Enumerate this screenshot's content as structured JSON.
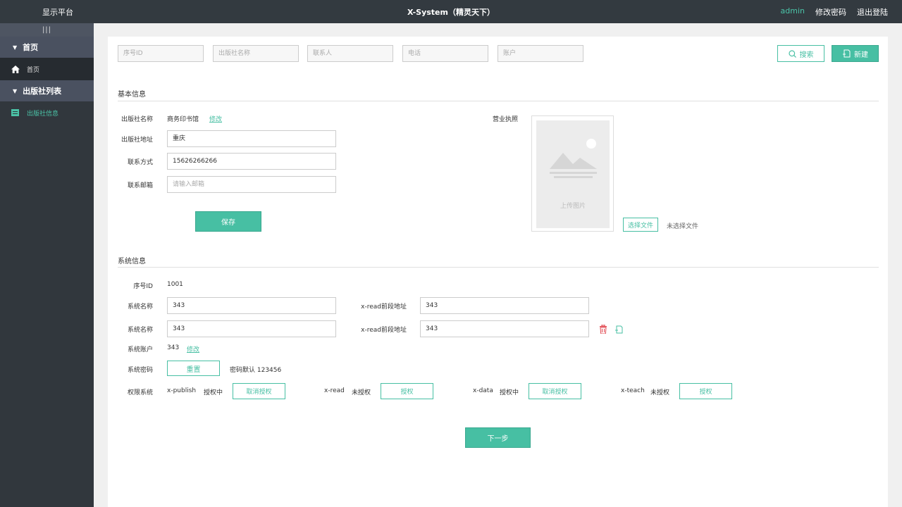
{
  "topbar": {
    "brand": "显示平台",
    "title": "X-System（精灵天下）",
    "user": "admin",
    "change_password": "修改密码",
    "logout": "退出登陆"
  },
  "sidebar": {
    "collapse": "|||",
    "groups": [
      {
        "label": "首页",
        "items": [
          {
            "label": "首页",
            "icon": "home-icon"
          }
        ]
      },
      {
        "label": "出版社列表",
        "items": [
          {
            "label": "出版社信息",
            "icon": "list-icon"
          }
        ]
      }
    ]
  },
  "search": {
    "placeholders": [
      "序号ID",
      "出版社名称",
      "联系人",
      "电话",
      "账户"
    ],
    "search_label": "搜索",
    "new_label": "新建"
  },
  "basic": {
    "section_title": "基本信息",
    "name_label": "出版社名称",
    "name_value": "商务印书馆",
    "edit_link": "修改",
    "address_label": "出版社地址",
    "address_value": "重庆",
    "phone_label": "联系方式",
    "phone_value": "15626266266",
    "email_label": "联系邮箱",
    "email_placeholder": "请输入邮箱",
    "save_label": "保存",
    "license_label": "营业执照",
    "upload_text": "上传图片",
    "choose_file": "选择文件",
    "no_file": "未选择文件"
  },
  "system": {
    "section_title": "系统信息",
    "id_label": "序号ID",
    "id_value": "1001",
    "name_label": "系统名称",
    "url_label": "x-read前段地址",
    "rows": [
      {
        "name": "343",
        "url": "343"
      },
      {
        "name": "343",
        "url": "343"
      }
    ],
    "account_label": "系统账户",
    "account_value": "343",
    "account_edit": "修改",
    "password_label": "系统密码",
    "reset_label": "重置",
    "password_hint": "密码默认 123456",
    "perm_label": "权限系统",
    "permissions": [
      {
        "name": "x-publish",
        "status": "授权中",
        "action": "取消授权"
      },
      {
        "name": "x-read",
        "status": "未授权",
        "action": "授权"
      },
      {
        "name": "x-data",
        "status": "授权中",
        "action": "取消授权"
      },
      {
        "name": "x-teach",
        "status": "未授权",
        "action": "授权"
      }
    ],
    "next_label": "下一步"
  },
  "colors": {
    "accent": "#47bfa3",
    "sidebar": "#31373d",
    "topbar": "#333a40",
    "danger": "#e0454d"
  }
}
